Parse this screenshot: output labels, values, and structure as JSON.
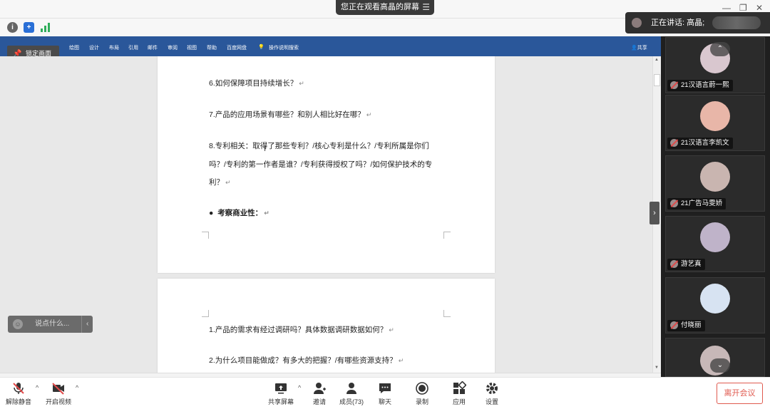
{
  "banner": {
    "text": "您正在观看高晶的屏幕",
    "menu_icon": "menu-icon"
  },
  "speaking": {
    "label": "正在讲话: 高晶;"
  },
  "ribbon": {
    "tabs": [
      "绘图",
      "设计",
      "布局",
      "引用",
      "邮件",
      "审阅",
      "视图",
      "帮助",
      "百度网盘",
      "操作说明搜索"
    ],
    "share": "共享"
  },
  "lock_screen": {
    "label": "锁定画面"
  },
  "document": {
    "page1_lines": [
      "6.如何保障项目持续增长？",
      "7.产品的应用场景有哪些？和别人相比好在哪？",
      "8.专利相关：取得了那些专利？/核心专利是什么？/专利所属是你们",
      "吗？/专利的第一作者是谁？/专利获得授权了吗？/如何保护技术的专",
      "利？"
    ],
    "bullet_heading": "考察商业性：",
    "page2_lines": [
      "1.产品的需求有经过调研吗？具体数据调研数据如何？",
      "2.为什么项目能做成？有多大的把握？/有哪些资源支持？"
    ],
    "paragraph_mark": "↵"
  },
  "chat_input": {
    "placeholder": "说点什么..."
  },
  "participants": [
    {
      "name": "21汉语言蔚一熙",
      "avatar_color": "#d9c7cf"
    },
    {
      "name": "21汉语言李凯文",
      "avatar_color": "#e8b6a8"
    },
    {
      "name": "21广告马雯娇",
      "avatar_color": "#c9b5b0"
    },
    {
      "name": "游艺真",
      "avatar_color": "#bfb3c9"
    },
    {
      "name": "付晓丽",
      "avatar_color": "#d7e3f2"
    }
  ],
  "toolbar": {
    "mute": "解除静音",
    "video": "开启视频",
    "share_screen": "共享屏幕",
    "invite": "邀请",
    "members": "成员(73)",
    "chat": "聊天",
    "record": "录制",
    "apps": "应用",
    "settings": "设置",
    "leave": "离开会议"
  },
  "colors": {
    "ribbon": "#2a579a",
    "leave": "#e05a4f",
    "security_green": "#2fae5a",
    "security_blue": "#2a6fd6"
  }
}
